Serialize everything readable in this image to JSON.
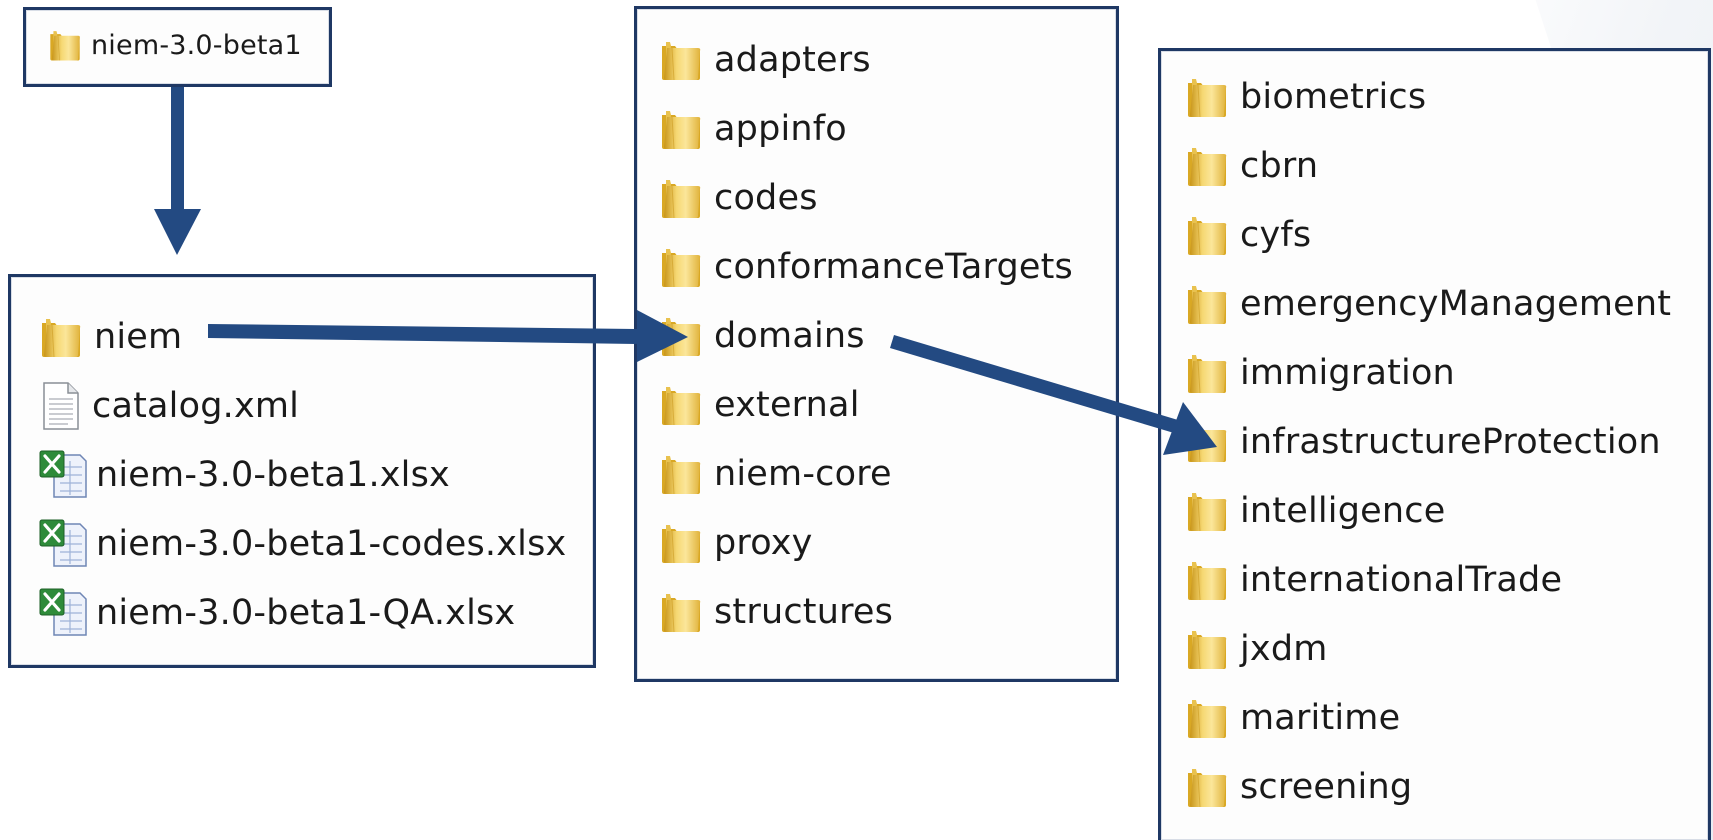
{
  "root": {
    "label": "niem-3.0-beta1",
    "icon": "folder-icon"
  },
  "level1": {
    "items": [
      {
        "label": "niem",
        "icon": "folder-icon"
      },
      {
        "label": "catalog.xml",
        "icon": "xml-file-icon"
      },
      {
        "label": "niem-3.0-beta1.xlsx",
        "icon": "excel-file-icon"
      },
      {
        "label": "niem-3.0-beta1-codes.xlsx",
        "icon": "excel-file-icon"
      },
      {
        "label": "niem-3.0-beta1-QA.xlsx",
        "icon": "excel-file-icon"
      }
    ]
  },
  "level2": {
    "items": [
      {
        "label": "adapters",
        "icon": "folder-icon"
      },
      {
        "label": "appinfo",
        "icon": "folder-icon"
      },
      {
        "label": "codes",
        "icon": "folder-icon"
      },
      {
        "label": "conformanceTargets",
        "icon": "folder-icon"
      },
      {
        "label": "domains",
        "icon": "folder-icon"
      },
      {
        "label": "external",
        "icon": "folder-icon"
      },
      {
        "label": "niem-core",
        "icon": "folder-icon"
      },
      {
        "label": "proxy",
        "icon": "folder-icon"
      },
      {
        "label": "structures",
        "icon": "folder-icon"
      }
    ]
  },
  "level3": {
    "items": [
      {
        "label": "biometrics",
        "icon": "folder-icon"
      },
      {
        "label": "cbrn",
        "icon": "folder-icon"
      },
      {
        "label": "cyfs",
        "icon": "folder-icon"
      },
      {
        "label": "emergencyManagement",
        "icon": "folder-icon"
      },
      {
        "label": "immigration",
        "icon": "folder-icon"
      },
      {
        "label": "infrastructureProtection",
        "icon": "folder-icon"
      },
      {
        "label": "intelligence",
        "icon": "folder-icon"
      },
      {
        "label": "internationalTrade",
        "icon": "folder-icon"
      },
      {
        "label": "jxdm",
        "icon": "folder-icon"
      },
      {
        "label": "maritime",
        "icon": "folder-icon"
      },
      {
        "label": "screening",
        "icon": "folder-icon"
      }
    ]
  },
  "colors": {
    "border": "#1f3864",
    "arrow": "#234a82",
    "folder_light": "#f7dc7a",
    "folder_dark": "#d9a824",
    "excel_green": "#2e8b3a"
  }
}
